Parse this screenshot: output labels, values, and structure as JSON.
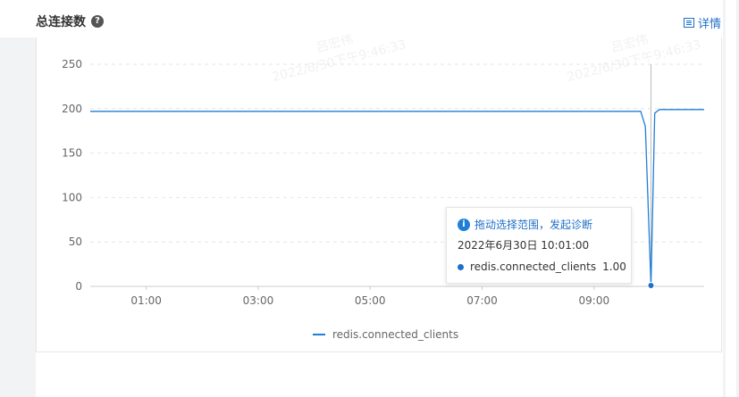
{
  "header": {
    "title": "总连接数",
    "help_icon": "question-circle-icon"
  },
  "detail": {
    "label": "详情",
    "icon": "detail-panel-icon"
  },
  "watermarks": [
    {
      "name": "吕宏伟",
      "timestamp": "2022/6/30下午9:46:33"
    },
    {
      "name": "吕宏伟",
      "timestamp": "2022/6/30下午9:46:33"
    }
  ],
  "tooltip": {
    "hint": "拖动选择范围，发起诊断",
    "time": "2022年6月30日 10:01:00",
    "series_name": "redis.connected_clients",
    "value": "1.00"
  },
  "legend": {
    "label": "redis.connected_clients"
  },
  "colors": {
    "series": "#1f7ed8",
    "link": "#1f6fc7",
    "grid": "#e6e6e6"
  },
  "chart_data": {
    "type": "line",
    "title": "总连接数",
    "xlabel": "",
    "ylabel": "",
    "x_ticks": [
      "01:00",
      "03:00",
      "05:00",
      "07:00",
      "09:00"
    ],
    "y_ticks": [
      0,
      50,
      100,
      150,
      200,
      250
    ],
    "ylim": [
      0,
      250
    ],
    "grid": true,
    "legend_position": "bottom",
    "series": [
      {
        "name": "redis.connected_clients",
        "points": [
          [
            "00:00",
            197
          ],
          [
            "00:30",
            197
          ],
          [
            "01:00",
            197
          ],
          [
            "01:30",
            197
          ],
          [
            "02:00",
            197
          ],
          [
            "02:30",
            197
          ],
          [
            "03:00",
            197
          ],
          [
            "03:30",
            197
          ],
          [
            "04:00",
            197
          ],
          [
            "04:30",
            197
          ],
          [
            "05:00",
            197
          ],
          [
            "05:30",
            197
          ],
          [
            "06:00",
            197
          ],
          [
            "06:30",
            197
          ],
          [
            "07:00",
            197
          ],
          [
            "07:30",
            197
          ],
          [
            "08:00",
            197
          ],
          [
            "08:30",
            197
          ],
          [
            "09:00",
            197
          ],
          [
            "09:30",
            197
          ],
          [
            "09:50",
            197
          ],
          [
            "09:55",
            180
          ],
          [
            "10:01",
            1
          ],
          [
            "10:05",
            195
          ],
          [
            "10:10",
            199
          ],
          [
            "10:30",
            199
          ],
          [
            "10:58",
            199
          ]
        ]
      }
    ],
    "cursor_x": "10:01"
  }
}
